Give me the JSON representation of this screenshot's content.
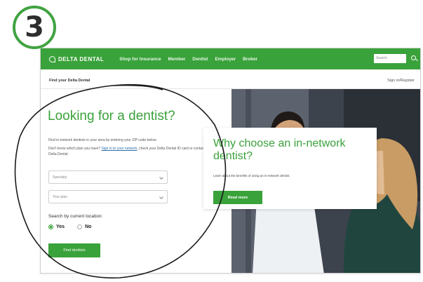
{
  "step": {
    "number": "3"
  },
  "nav": {
    "logo_text": "DELTA DENTAL",
    "links": [
      "Shop for Insurance",
      "Member",
      "Dentist",
      "Employer",
      "Broker"
    ],
    "search_placeholder": "Search"
  },
  "subbar": {
    "title": "Find your Delta Dental",
    "right_link": "Sign in/Register"
  },
  "finder": {
    "headline": "Looking for a dentist?",
    "desc_1": "Find in-network dentists in your area by entering your ZIP code below.",
    "desc_2_pre": "Don't know which plan you have? ",
    "desc_2_link": "Sign in to your network",
    "desc_2_post": ", check your Delta Dental ID card or contact your Delta Dental.",
    "select_specialty": "Specialty",
    "select_plan": "Your plan",
    "location_label": "Search by current location:",
    "radio_yes": "Yes",
    "radio_no": "No",
    "find_button": "Find dentists"
  },
  "promo": {
    "title": "Why choose an in-network dentist?",
    "text": "Learn about the benefits of using an in-network dentist.",
    "button": "Read more"
  },
  "colors": {
    "brand_green": "#3aa23b",
    "link_blue": "#2e6fa8"
  }
}
